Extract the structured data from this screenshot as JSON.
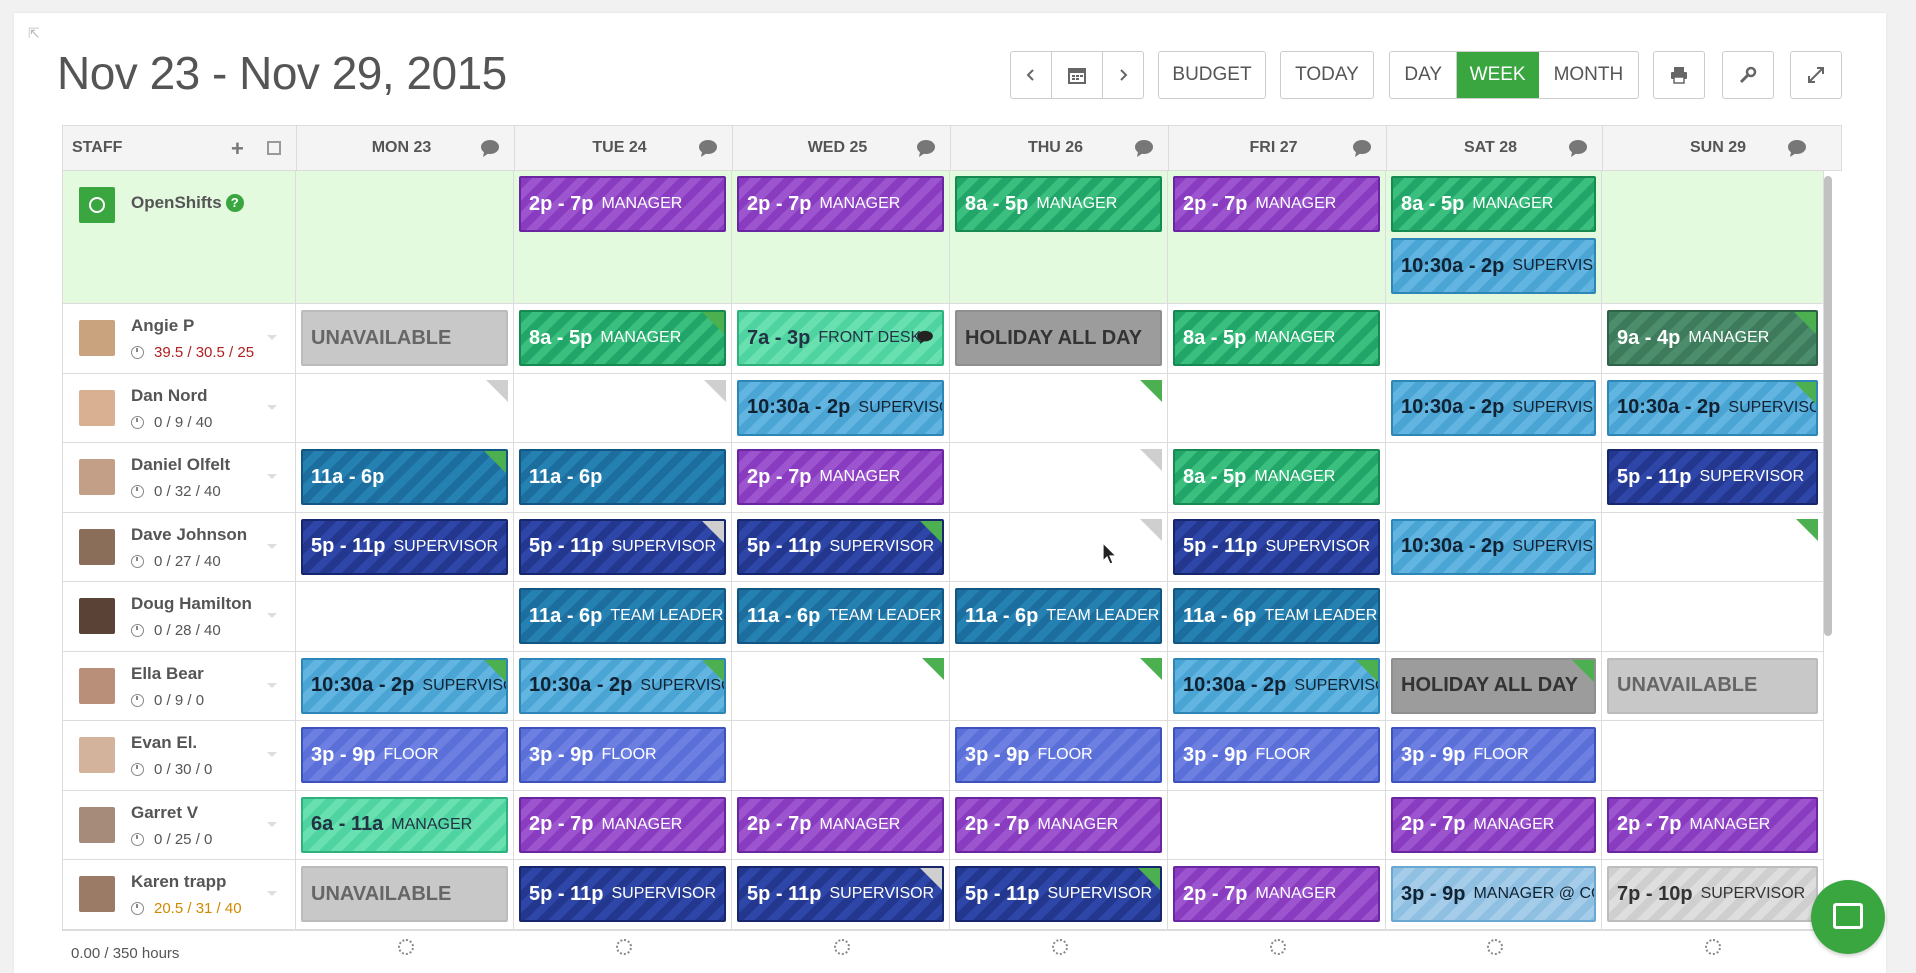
{
  "header": {
    "title": "Nov 23 - Nov 29, 2015",
    "budget_label": "BUDGET",
    "today_label": "TODAY",
    "views": [
      "DAY",
      "WEEK",
      "MONTH"
    ],
    "active_view": "WEEK"
  },
  "columns": {
    "staff": "STAFF",
    "days": [
      "MON 23",
      "TUE 24",
      "WED 25",
      "THU 26",
      "FRI 27",
      "SAT 28",
      "SUN 29"
    ]
  },
  "openshifts": {
    "label": "OpenShifts",
    "help": "?"
  },
  "staff": [
    {
      "name": "Angie P",
      "hours": "39.5 / 30.5 / 25",
      "hours_color": "#b02020"
    },
    {
      "name": "Dan Nord",
      "hours": "0 / 9 / 40"
    },
    {
      "name": "Daniel Olfelt",
      "hours": "0 / 32 / 40"
    },
    {
      "name": "Dave Johnson",
      "hours": "0 / 27 / 40"
    },
    {
      "name": "Doug Hamilton",
      "hours": "0 / 28 / 40"
    },
    {
      "name": "Ella Bear",
      "hours": "0 / 9 / 0"
    },
    {
      "name": "Evan El.",
      "hours": "0 / 30 / 0"
    },
    {
      "name": "Garret V",
      "hours": "0 / 25 / 0"
    },
    {
      "name": "Karen trapp",
      "hours": "20.5 / 31 / 40",
      "hours_color": "#d08a00"
    }
  ],
  "shift_labels": {
    "s_2p7p": "2p - 7p",
    "s_8a5p": "8a - 5p",
    "s_1030a2p": "10:30a - 2p",
    "s_7a3p": "7a - 3p",
    "s_9a4p": "9a - 4p",
    "s_11a6p": "11a - 6p",
    "s_5p11p": "5p - 11p",
    "s_3p9p": "3p - 9p",
    "s_6a11a": "6a - 11a",
    "s_7p10p": "7p - 10p",
    "unavailable": "UNAVAILABLE",
    "holiday": "HOLIDAY ALL DAY"
  },
  "role_labels": {
    "manager": "MANAGER",
    "supervisor": "SUPERVISOR",
    "supervisor_cut": "SUPERVISO",
    "front_desk": "FRONT DESK",
    "team_leader": "TEAM LEADER",
    "floor": "FLOOR",
    "manager_at": "MANAGER @ CO"
  },
  "footer": {
    "hours": "0.00 / 350 hours"
  },
  "colors": {
    "accent": "#3aa640",
    "manager": "#8a3cc0",
    "manager_green": "#22a569",
    "supervisor": "#4aa4d4",
    "supervisor_dark": "#23378f",
    "team_leader": "#1c6e9e",
    "floor": "#5a6fd8"
  }
}
